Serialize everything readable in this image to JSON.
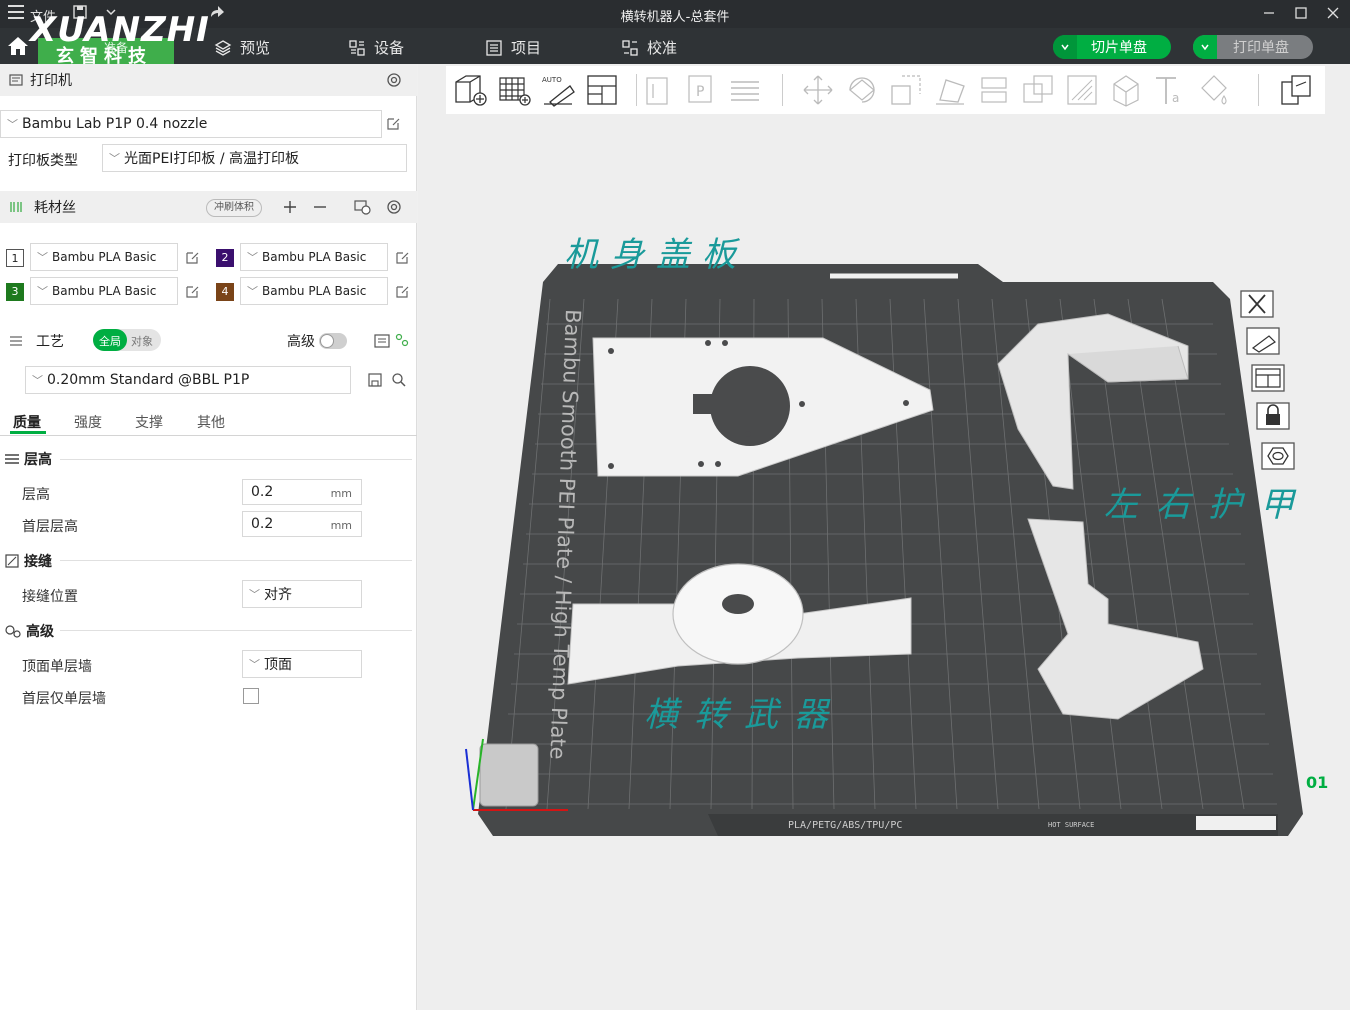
{
  "titlebar": {
    "file_label": "文件",
    "title": "横转机器人-总套件"
  },
  "nav": {
    "brand": "XUANZHI",
    "brand_sub": "玄智科技",
    "prepare_label": "准备",
    "tabs": [
      "预览",
      "设备",
      "项目",
      "校准"
    ],
    "slice_button": "切片单盘",
    "print_button": "打印单盘"
  },
  "printer": {
    "section_title": "打印机",
    "printer_value": "Bambu Lab P1P 0.4 nozzle",
    "plate_type_label": "打印板类型",
    "plate_type_value": "光面PEI打印板 / 高温打印板"
  },
  "filament": {
    "section_title": "耗材丝",
    "flush_label": "冲刷体积",
    "slots": [
      {
        "num": "1",
        "name": "Bambu PLA Basic",
        "color": "#ffffff"
      },
      {
        "num": "2",
        "name": "Bambu PLA Basic",
        "color": "#3a0f6e"
      },
      {
        "num": "3",
        "name": "Bambu PLA Basic",
        "color": "#1e7a1e"
      },
      {
        "num": "4",
        "name": "Bambu PLA Basic",
        "color": "#7a4418"
      }
    ]
  },
  "process": {
    "section_title": "工艺",
    "toggle_global": "全局",
    "toggle_object": "对象",
    "advanced_label": "高级",
    "preset_value": "0.20mm Standard @BBL P1P",
    "tabs": [
      "质量",
      "强度",
      "支撑",
      "其他"
    ],
    "groups": {
      "layer_height": {
        "title": "层高",
        "rows": [
          {
            "label": "层高",
            "value": "0.2",
            "unit": "mm"
          },
          {
            "label": "首层层高",
            "value": "0.2",
            "unit": "mm"
          }
        ]
      },
      "seam": {
        "title": "接缝",
        "position_label": "接缝位置",
        "position_value": "对齐"
      },
      "advanced": {
        "title": "高级",
        "top_wall_label": "顶面单层墙",
        "top_wall_value": "顶面",
        "first_layer_wall_label": "首层仅单层墙"
      }
    }
  },
  "scene": {
    "plate_text": "Bambu Smooth PEI Plate / High Temp Plate",
    "label_cover": "机身盖板",
    "label_armor": "左右护甲",
    "label_weapon": "横转武器",
    "plate_number": "01",
    "plate_footer": "PLA/PETG/ABS/TPU/PC",
    "hot_surface": "HOT SURFACE"
  },
  "colors": {
    "accent": "#00ae42",
    "annotation": "#1a9a9a"
  }
}
